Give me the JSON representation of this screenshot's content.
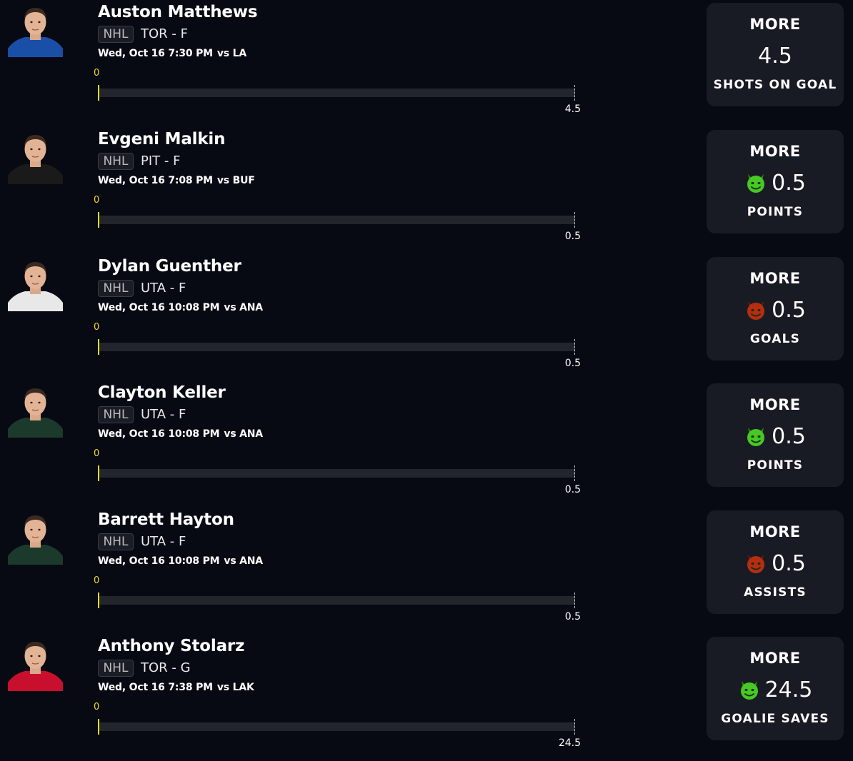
{
  "colors": {
    "background": "#070a13",
    "card": "#191b24",
    "track": "#23252d",
    "accent_yellow": "#f0dc1f",
    "demon_green": "#47c825",
    "demon_red": "#b72d10"
  },
  "props": [
    {
      "name": "Auston Matthews",
      "league": "NHL",
      "team_pos": "TOR - F",
      "game_time": "Wed, Oct 16 7:30 PM",
      "opponent": "vs LA",
      "progress_label": "0",
      "progress_value": 0,
      "line_label": "4.5",
      "pick": "MORE",
      "value": "4.5",
      "stat": "SHOTS ON GOAL",
      "badge_icon": "none",
      "jersey": "#1a4fa8"
    },
    {
      "name": "Evgeni Malkin",
      "league": "NHL",
      "team_pos": "PIT - F",
      "game_time": "Wed, Oct 16 7:08 PM",
      "opponent": "vs BUF",
      "progress_label": "0",
      "progress_value": 0,
      "line_label": "0.5",
      "pick": "MORE",
      "value": "0.5",
      "stat": "POINTS",
      "badge_icon": "green-demon-icon",
      "jersey": "#1a1a1a"
    },
    {
      "name": "Dylan Guenther",
      "league": "NHL",
      "team_pos": "UTA - F",
      "game_time": "Wed, Oct 16 10:08 PM",
      "opponent": "vs ANA",
      "progress_label": "0",
      "progress_value": 0,
      "line_label": "0.5",
      "pick": "MORE",
      "value": "0.5",
      "stat": "GOALS",
      "badge_icon": "red-demon-icon",
      "jersey": "#e8e8e8"
    },
    {
      "name": "Clayton Keller",
      "league": "NHL",
      "team_pos": "UTA - F",
      "game_time": "Wed, Oct 16 10:08 PM",
      "opponent": "vs ANA",
      "progress_label": "0",
      "progress_value": 0,
      "line_label": "0.5",
      "pick": "MORE",
      "value": "0.5",
      "stat": "POINTS",
      "badge_icon": "green-demon-icon",
      "jersey": "#1c3a2c"
    },
    {
      "name": "Barrett Hayton",
      "league": "NHL",
      "team_pos": "UTA - F",
      "game_time": "Wed, Oct 16 10:08 PM",
      "opponent": "vs ANA",
      "progress_label": "0",
      "progress_value": 0,
      "line_label": "0.5",
      "pick": "MORE",
      "value": "0.5",
      "stat": "ASSISTS",
      "badge_icon": "red-demon-icon",
      "jersey": "#1c3a2c"
    },
    {
      "name": "Anthony Stolarz",
      "league": "NHL",
      "team_pos": "TOR - G",
      "game_time": "Wed, Oct 16 7:38 PM",
      "opponent": "vs LAK",
      "progress_label": "0",
      "progress_value": 0,
      "line_label": "24.5",
      "pick": "MORE",
      "value": "24.5",
      "stat": "GOALIE SAVES",
      "badge_icon": "green-demon-icon",
      "jersey": "#c8102e"
    }
  ]
}
